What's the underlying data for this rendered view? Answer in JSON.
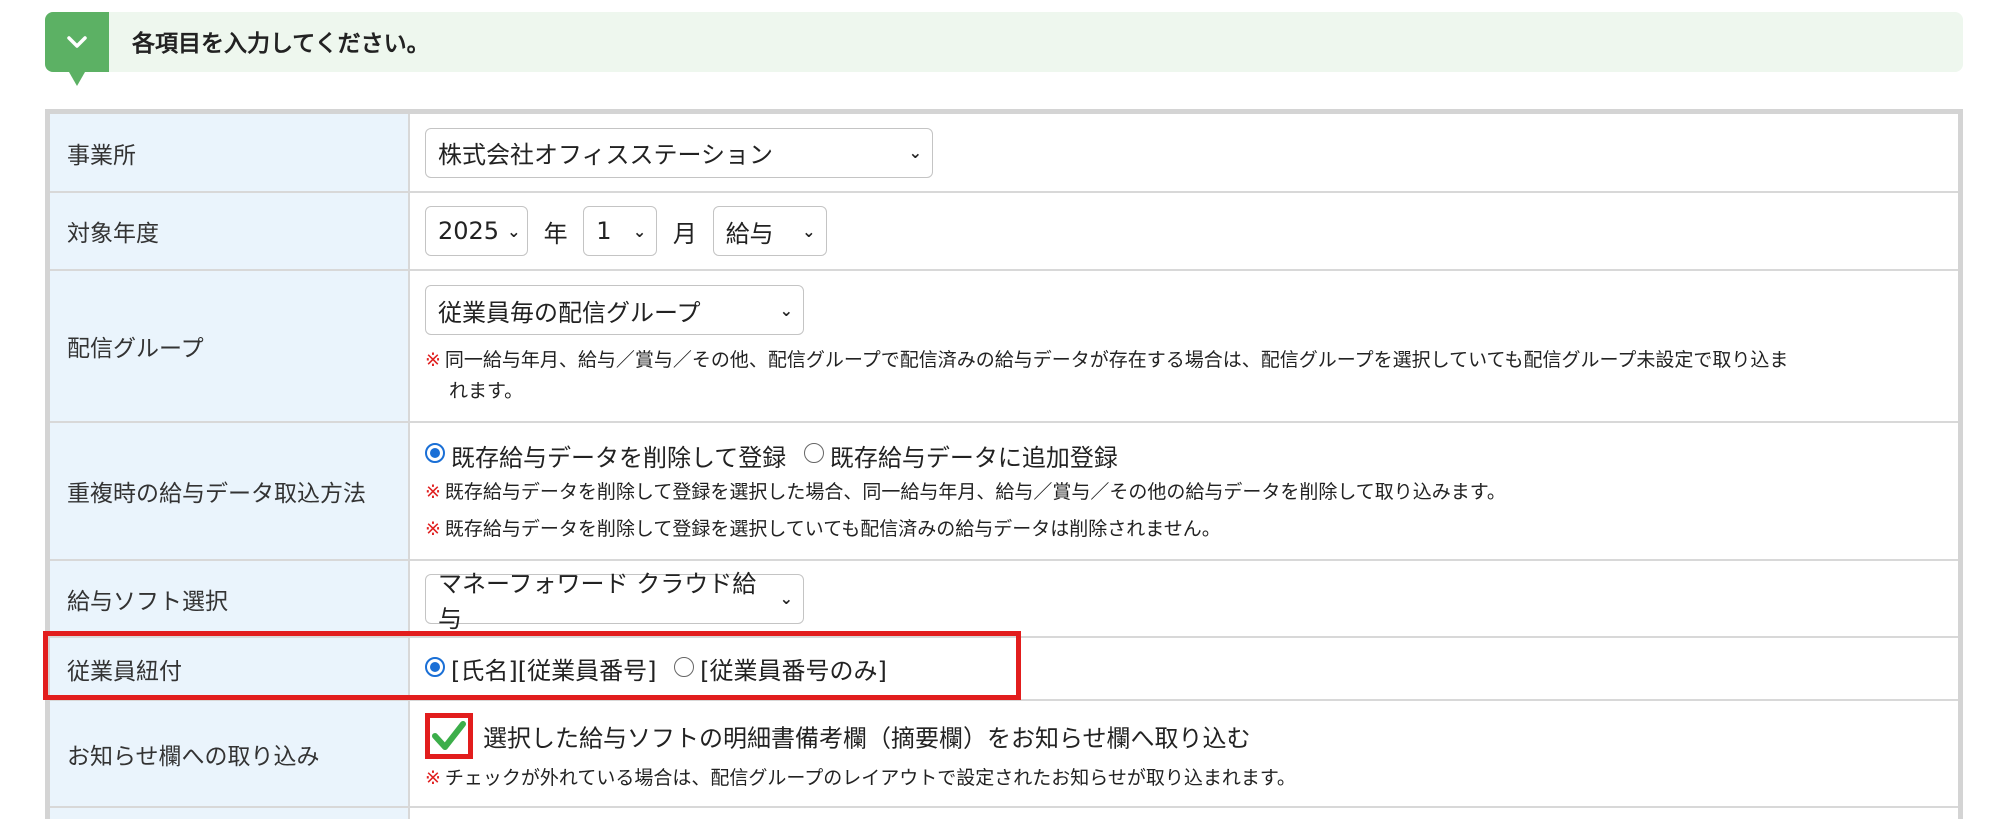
{
  "header": {
    "title": "各項目を入力してください。",
    "icon": "chevron-down-icon",
    "accent_color": "#5cb164"
  },
  "rows": {
    "office": {
      "label": "事業所",
      "value": "株式会社オフィスステーション"
    },
    "period": {
      "label": "対象年度",
      "year": "2025",
      "year_unit": "年",
      "month": "1",
      "month_unit": "月",
      "type": "給与"
    },
    "group": {
      "label": "配信グループ",
      "value": "従業員毎の配信グループ",
      "note_mark": "※",
      "note_line1": "同一給与年月、給与／賞与／その他、配信グループで配信済みの給与データが存在する場合は、配信グループを選択していても配信グループ未設定で取り込ま",
      "note_line2": "れます。"
    },
    "duplicate": {
      "label": "重複時の給与データ取込方法",
      "option1": "既存給与データを削除して登録",
      "option2": "既存給与データに追加登録",
      "selected": "option1",
      "note_mark": "※",
      "note1": "既存給与データを削除して登録を選択した場合、同一給与年月、給与／賞与／その他の給与データを削除して取り込みます。",
      "note2": "既存給与データを削除して登録を選択していても配信済みの給与データは削除されません。"
    },
    "software": {
      "label": "給与ソフト選択",
      "value": "マネーフォワード クラウド給与"
    },
    "employee_link": {
      "label": "従業員紐付",
      "option1": "[氏名][従業員番号]",
      "option2": "[従業員番号のみ]",
      "selected": "option1"
    },
    "notice": {
      "label": "お知らせ欄への取り込み",
      "checkbox_label": "選択した給与ソフトの明細書備考欄（摘要欄）をお知らせ欄へ取り込む",
      "checked": true,
      "note_mark": "※",
      "note": "チェックが外れている場合は、配信グループのレイアウトで設定されたお知らせが取り込まれます。"
    }
  },
  "colors": {
    "label_bg": "#eaf4fc",
    "highlight_red": "#e21d1d",
    "radio_blue": "#1a6fd6",
    "check_green": "#3cae4a"
  }
}
